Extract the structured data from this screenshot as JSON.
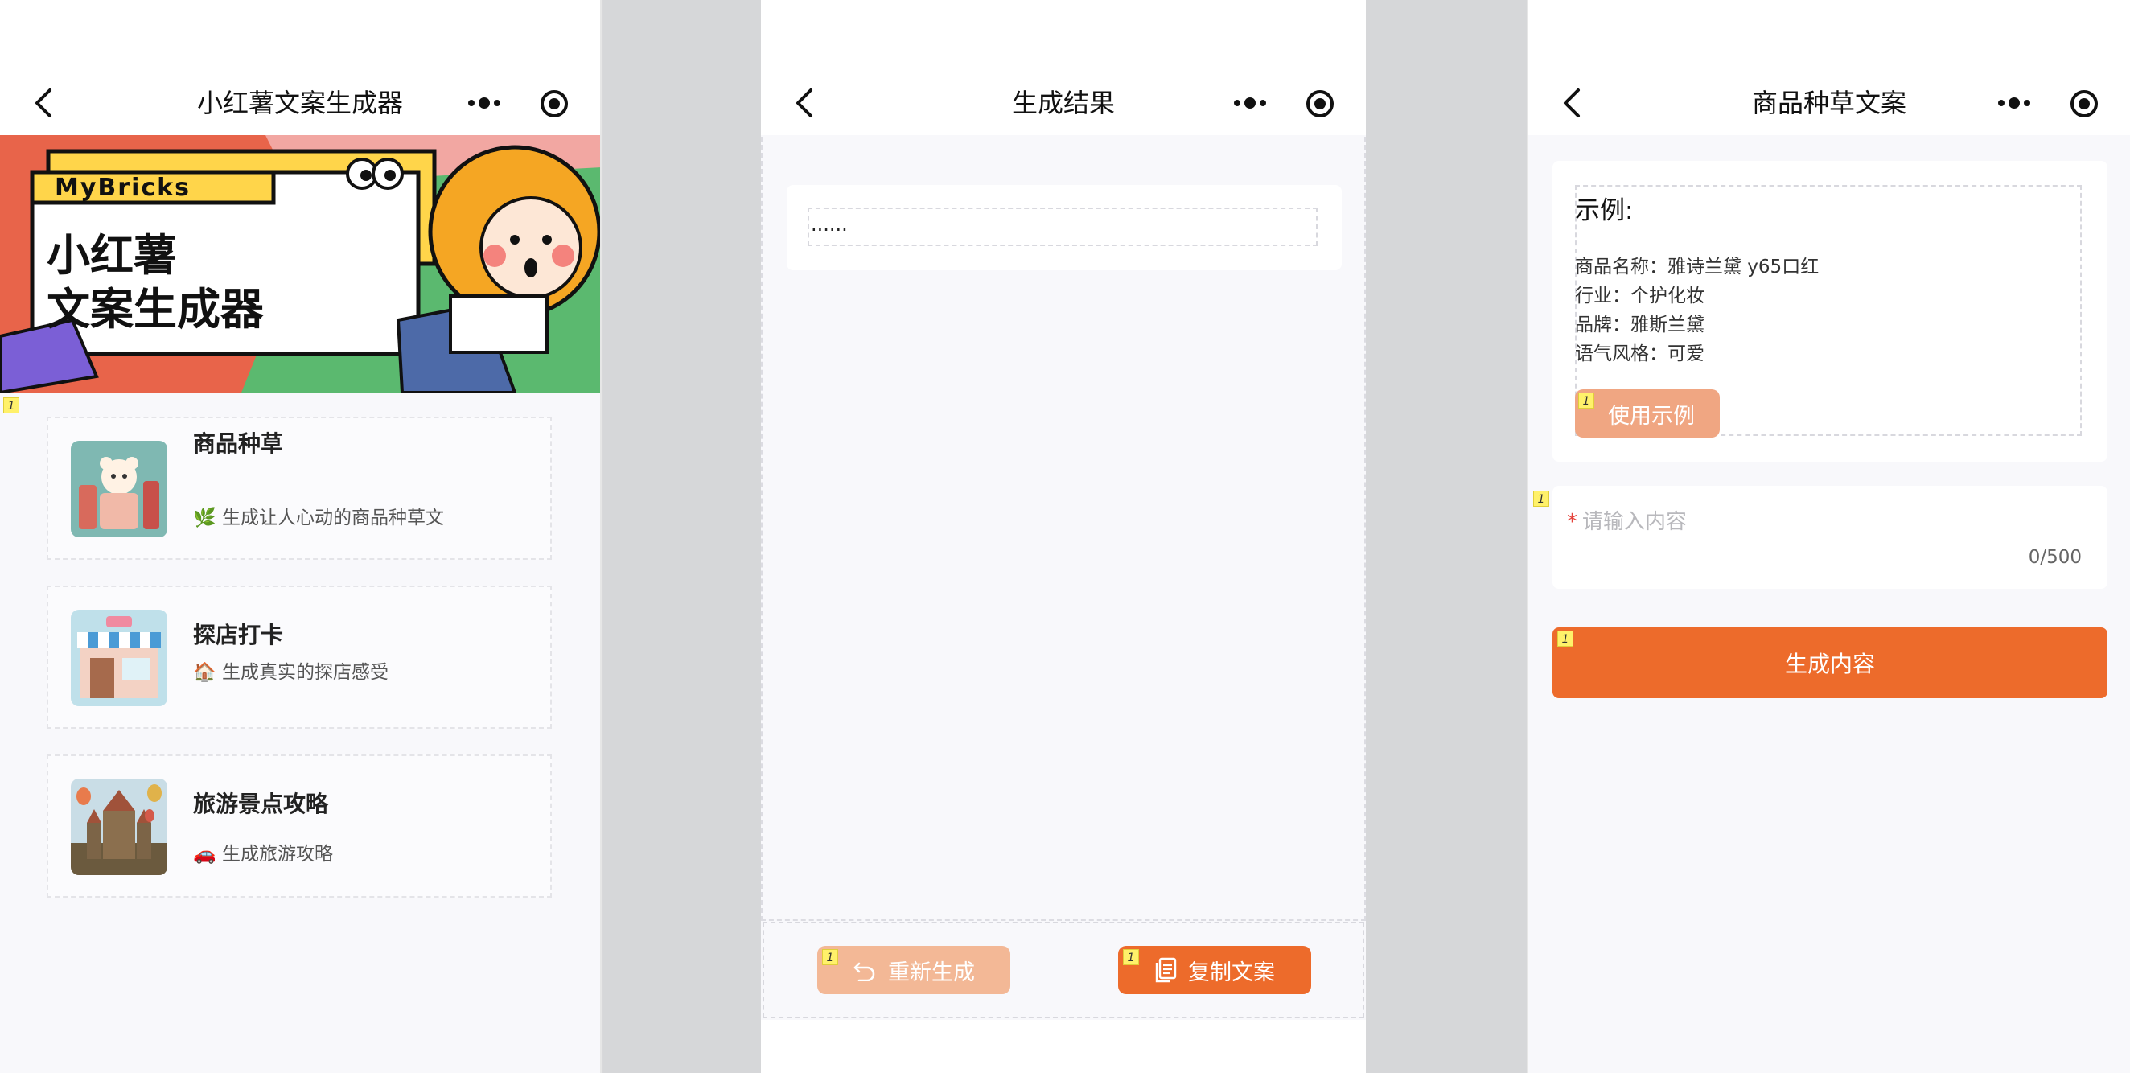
{
  "colors": {
    "accent": "#ed6b2b",
    "accent_light": "#f3b896",
    "gutter": "#d6d7d9",
    "page_bg": "#f8f8fb"
  },
  "screen1": {
    "title": "小红薯文案生成器",
    "banner": {
      "brand": "MyBricks",
      "line1": "小红薯",
      "line2": "文案生成器"
    },
    "badge": "1",
    "cards": [
      {
        "title": "商品种草",
        "desc": "生成让人心动的商品种草文",
        "emoji": "🌿",
        "thumb": "cosmetics-bear"
      },
      {
        "title": "探店打卡",
        "desc": "生成真实的探店感受",
        "emoji": "🏠",
        "thumb": "storefront"
      },
      {
        "title": "旅游景点攻略",
        "desc": "生成旅游攻略",
        "emoji": "🚗",
        "thumb": "castle-balloons"
      }
    ]
  },
  "screen2": {
    "title": "生成结果",
    "result_text": "......",
    "regen_label": "重新生成",
    "copy_label": "复制文案",
    "badge": "1"
  },
  "screen3": {
    "title": "商品种草文案",
    "example_title": "示例:",
    "example_lines": [
      "商品名称：雅诗兰黛 y65口红",
      "行业：个护化妆",
      "品牌：雅斯兰黛",
      "语气风格：可爱"
    ],
    "use_example_label": "使用示例",
    "input_required_mark": "*",
    "input_placeholder": "请输入内容",
    "input_count": "0/500",
    "generate_label": "生成内容",
    "badge": "1"
  }
}
